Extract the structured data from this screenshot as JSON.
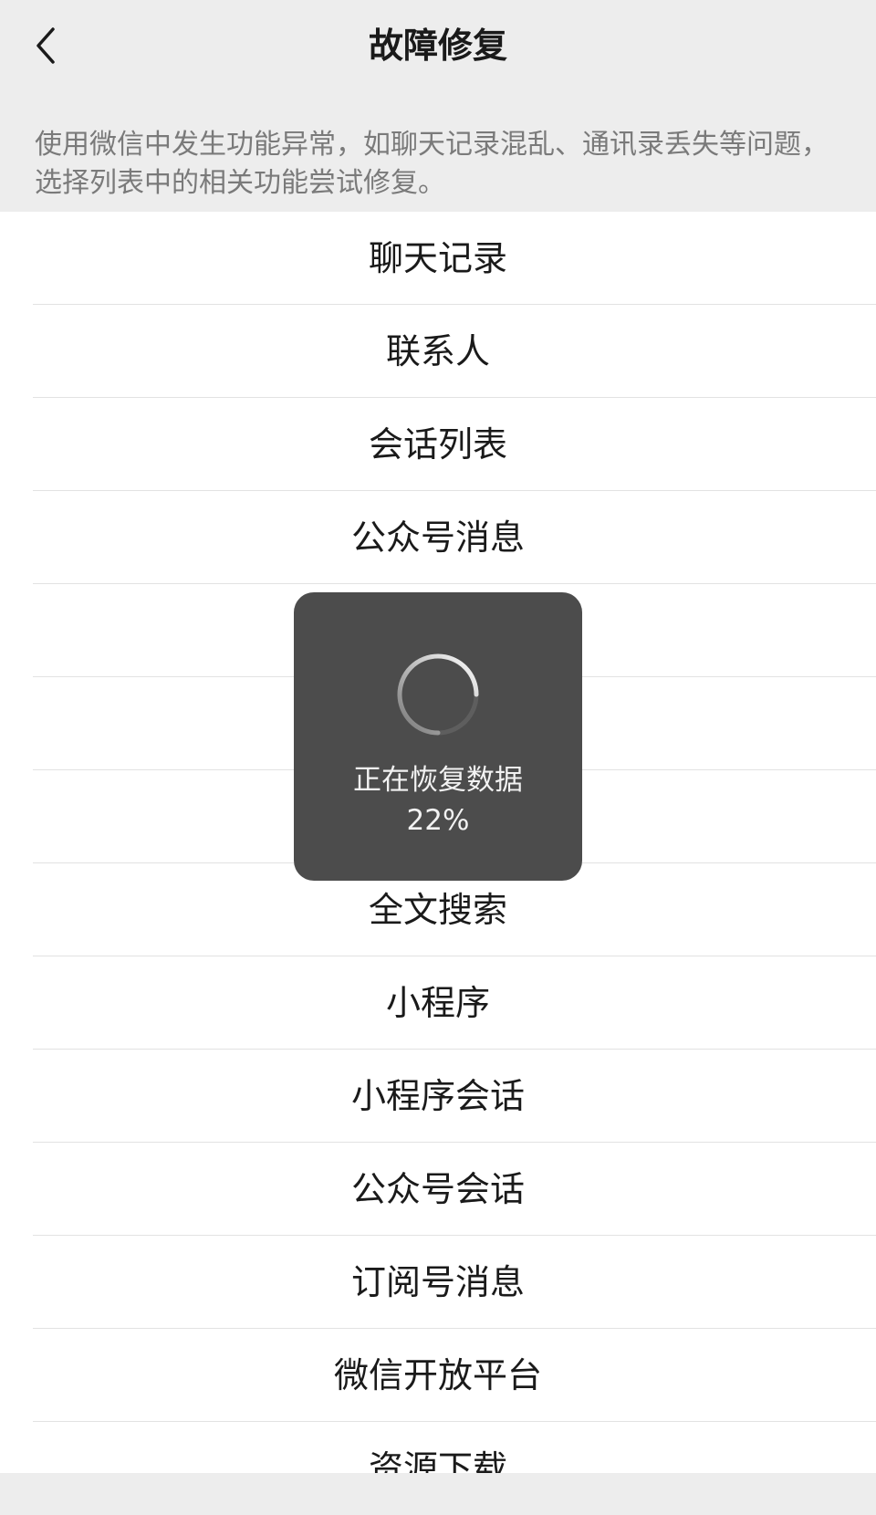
{
  "nav": {
    "title": "故障修复",
    "back_icon": "chevron-left-icon"
  },
  "description": "使用微信中发生功能异常，如聊天记录混乱、通讯录丢失等问题，选择列表中的相关功能尝试修复。",
  "list": {
    "items": [
      {
        "label": "聊天记录"
      },
      {
        "label": "联系人"
      },
      {
        "label": "会话列表"
      },
      {
        "label": "公众号消息"
      },
      {
        "label": ""
      },
      {
        "label": ""
      },
      {
        "label": ""
      },
      {
        "label": "全文搜索"
      },
      {
        "label": "小程序"
      },
      {
        "label": "小程序会话"
      },
      {
        "label": "公众号会话"
      },
      {
        "label": "订阅号消息"
      },
      {
        "label": "微信开放平台"
      },
      {
        "label": "资源下载"
      }
    ]
  },
  "loading_toast": {
    "message": "正在恢复数据",
    "progress_text": "22%",
    "progress": 0.22,
    "spinner_icon": "loading-spinner-icon"
  },
  "colors": {
    "background": "#ededed",
    "list_background": "#ffffff",
    "toast_background": "#4c4c4c",
    "text_primary": "#1a1a1a",
    "text_secondary": "#7a7a7a"
  }
}
